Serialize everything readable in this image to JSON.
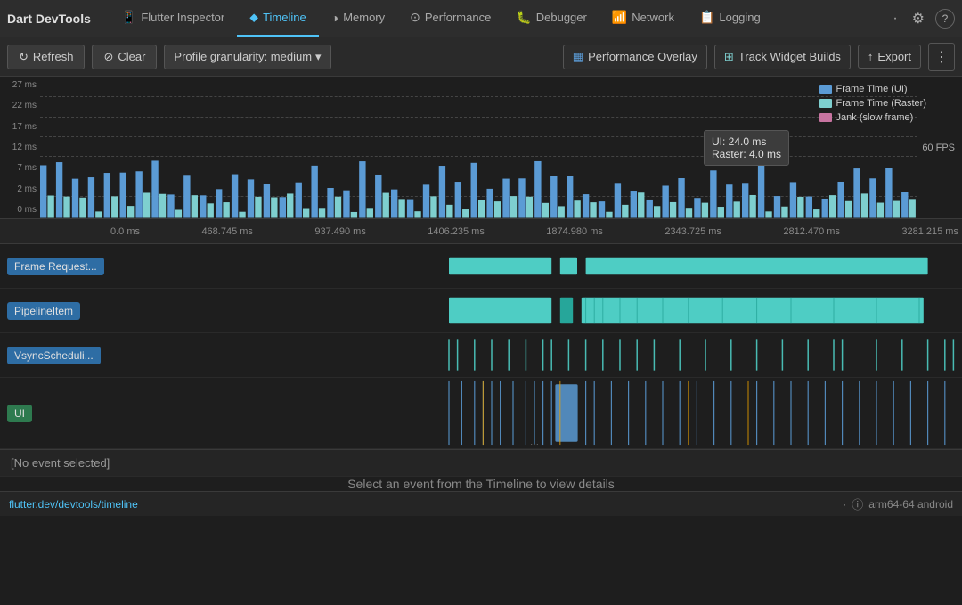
{
  "app": {
    "title": "Dart DevTools"
  },
  "nav": {
    "tabs": [
      {
        "id": "flutter-inspector",
        "label": "Flutter Inspector",
        "icon": "📱",
        "active": false
      },
      {
        "id": "timeline",
        "label": "Timeline",
        "icon": "📅",
        "active": true
      },
      {
        "id": "memory",
        "label": "Memory",
        "icon": "◑",
        "active": false
      },
      {
        "id": "performance",
        "label": "Performance",
        "icon": "⊙",
        "active": false
      },
      {
        "id": "debugger",
        "label": "Debugger",
        "icon": "🐛",
        "active": false
      },
      {
        "id": "network",
        "label": "Network",
        "icon": "📶",
        "active": false
      },
      {
        "id": "logging",
        "label": "Logging",
        "icon": "📋",
        "active": false
      }
    ],
    "settings_icon": "⚙",
    "help_icon": "?"
  },
  "toolbar": {
    "refresh_label": "Refresh",
    "clear_label": "Clear",
    "granularity_label": "Profile granularity: medium",
    "perf_overlay_label": "Performance Overlay",
    "track_widget_label": "Track Widget Builds",
    "export_label": "Export",
    "more_label": "⋮"
  },
  "chart": {
    "fps_label": "60 FPS",
    "y_labels": [
      "27 ms",
      "22 ms",
      "17 ms",
      "12 ms",
      "7 ms",
      "2 ms",
      "0 ms"
    ],
    "legend": [
      {
        "label": "Frame Time (UI)",
        "color": "#5b9bd5"
      },
      {
        "label": "Frame Time (Raster)",
        "color": "#7ecfcf"
      },
      {
        "label": "Jank (slow frame)",
        "color": "#c774a0"
      }
    ],
    "tooltip": {
      "line1": "UI: 24.0 ms",
      "line2": "Raster: 4.0 ms"
    }
  },
  "timeline": {
    "time_marks": [
      "0.0 ms",
      "468.745 ms",
      "937.490 ms",
      "1406.235 ms",
      "1874.980 ms",
      "2343.725 ms",
      "2812.470 ms",
      "3281.215 ms"
    ],
    "rows": [
      {
        "id": "frame-request",
        "label": "Frame Request...",
        "color": "#2e6da4"
      },
      {
        "id": "pipeline-item",
        "label": "PipelineItem",
        "color": "#2e6da4"
      },
      {
        "id": "vsync-scheduler",
        "label": "VsyncScheduli...",
        "color": "#2e6da4"
      },
      {
        "id": "ui",
        "label": "UI",
        "color": "#2e7a4f"
      }
    ]
  },
  "event_detail": {
    "text": "[No event selected]"
  },
  "bottom": {
    "select_text": "Select an event from the Timeline to view details"
  },
  "status": {
    "link": "flutter.dev/devtools/timeline",
    "dot": "·",
    "arch": "arm64-64 android"
  }
}
